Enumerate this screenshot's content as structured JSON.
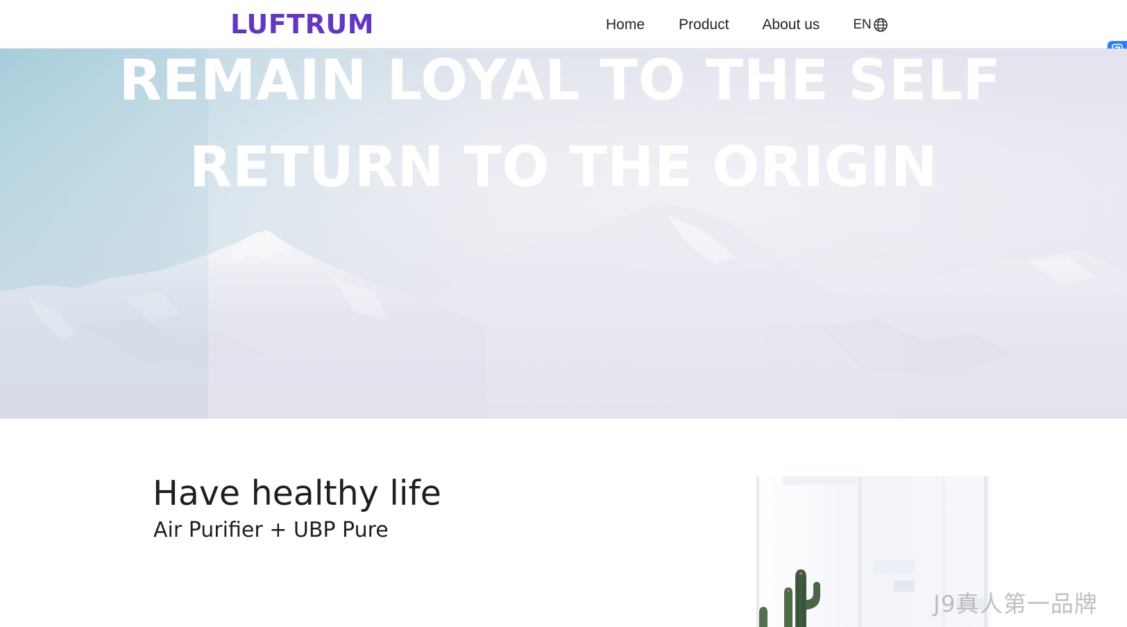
{
  "header": {
    "logo_text": "LUFTRUM",
    "nav": {
      "home": "Home",
      "product": "Product",
      "about": "About us"
    },
    "language": {
      "label": "EN",
      "icon": "globe-icon"
    }
  },
  "side_button": {
    "icon": "translate-icon"
  },
  "hero": {
    "line1": "REMAIN LOYAL TO THE SELF",
    "line2": "RETURN TO THE ORIGIN"
  },
  "intro": {
    "title": "Have healthy life",
    "subtitle": "Air Purifier + UBP Pure"
  },
  "watermark": {
    "text": "J9真人第一品牌"
  },
  "colors": {
    "brand": "#6337bf",
    "text": "#222222",
    "side_button": "#2d7ff9"
  }
}
